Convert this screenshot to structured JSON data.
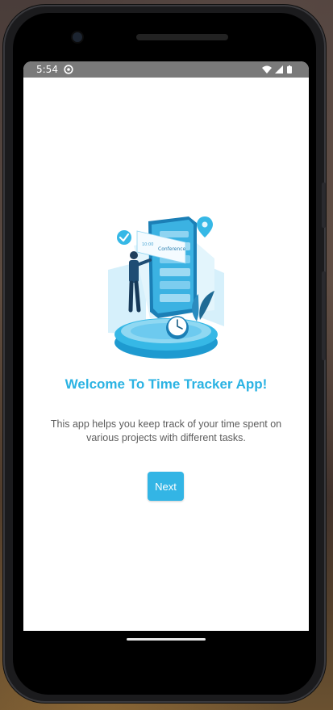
{
  "statusbar": {
    "time": "5:54",
    "icons": [
      "app-notification-icon",
      "wifi-icon",
      "signal-icon",
      "battery-icon"
    ]
  },
  "illustration": {
    "screen_text_1": "Conference",
    "screen_text_2": "10:00",
    "icon": "time-tracker-illustration"
  },
  "welcome": {
    "title": "Welcome To Time Tracker App!",
    "description": "This app helps you keep track of your time spent on various projects with different tasks."
  },
  "actions": {
    "next_label": "Next"
  },
  "colors": {
    "accent": "#2bb3e3",
    "button": "#33b5e5",
    "statusbar": "#7a7a7a",
    "text_secondary": "#5d5d5d"
  }
}
